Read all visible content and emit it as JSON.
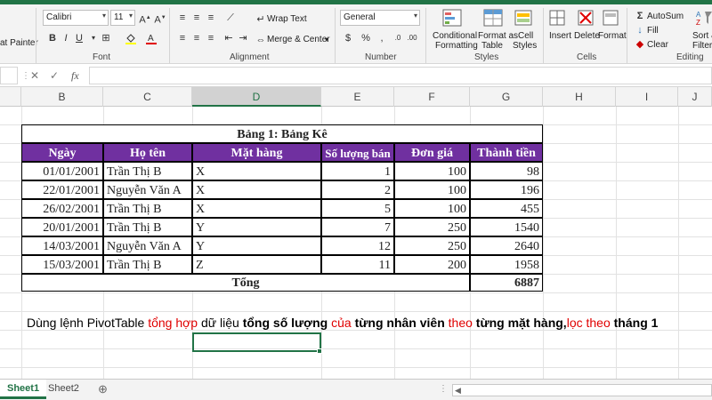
{
  "ribbon": {
    "clipboard": {
      "format_painter": "at Painter",
      "label": ""
    },
    "font": {
      "name": "Calibri",
      "size": "11",
      "bold": "B",
      "italic": "I",
      "underline": "U",
      "label": "Font"
    },
    "alignment": {
      "wrap_text": "Wrap Text",
      "merge_center": "Merge & Center",
      "label": "Alignment"
    },
    "number": {
      "format": "General",
      "label": "Number"
    },
    "styles": {
      "conditional": "Conditional",
      "conditional2": "Formatting",
      "format_as": "Format as",
      "format_as2": "Table",
      "cell": "Cell",
      "cell2": "Styles",
      "label": "Styles"
    },
    "cells": {
      "insert": "Insert",
      "delete": "Delete",
      "format": "Format",
      "label": "Cells"
    },
    "editing": {
      "autosum": "AutoSum",
      "fill": "Fill",
      "clear": "Clear",
      "sort": "Sort &",
      "filter": "Filter",
      "label": "Editing"
    }
  },
  "formula_bar": {
    "fx": "fx",
    "value": ""
  },
  "columns": [
    "B",
    "C",
    "D",
    "E",
    "F",
    "G",
    "H",
    "I",
    "J"
  ],
  "active_column": "D",
  "table": {
    "title": "Bảng 1: Bảng Kê",
    "headers": [
      "Ngày",
      "Họ tên",
      "Mặt hàng",
      "Số lượng bán",
      "Đơn giá",
      "Thành tiền"
    ],
    "rows": [
      [
        "01/01/2001",
        "Trần Thị B",
        "X",
        "1",
        "100",
        "98"
      ],
      [
        "22/01/2001",
        "Nguyễn Văn A",
        "X",
        "2",
        "100",
        "196"
      ],
      [
        "26/02/2001",
        "Trần Thị B",
        "X",
        "5",
        "100",
        "455"
      ],
      [
        "20/01/2001",
        "Trần Thị B",
        "Y",
        "7",
        "250",
        "1540"
      ],
      [
        "14/03/2001",
        "Nguyễn Văn A",
        "Y",
        "12",
        "250",
        "2640"
      ],
      [
        "15/03/2001",
        "Trần Thị B",
        "Z",
        "11",
        "200",
        "1958"
      ]
    ],
    "total_label": "Tổng",
    "total_value": "6887"
  },
  "instruction": {
    "p1": "Dùng lệnh PivotTable ",
    "p2": "tổng hợp",
    "p3": " dữ liệu ",
    "p4": "tổng số lượng",
    "p5": " của",
    "p6": " từng nhân viên",
    "p7": " theo",
    "p8": " từng mặt hàng,",
    "p9": "lọc theo",
    "p10": " tháng 1"
  },
  "sheets": [
    "Sheet1",
    "Sheet2"
  ],
  "active_sheet": "Sheet1",
  "colors": {
    "excel_green": "#217346",
    "header_purple": "#7030a0",
    "highlight_red": "#e00000"
  }
}
